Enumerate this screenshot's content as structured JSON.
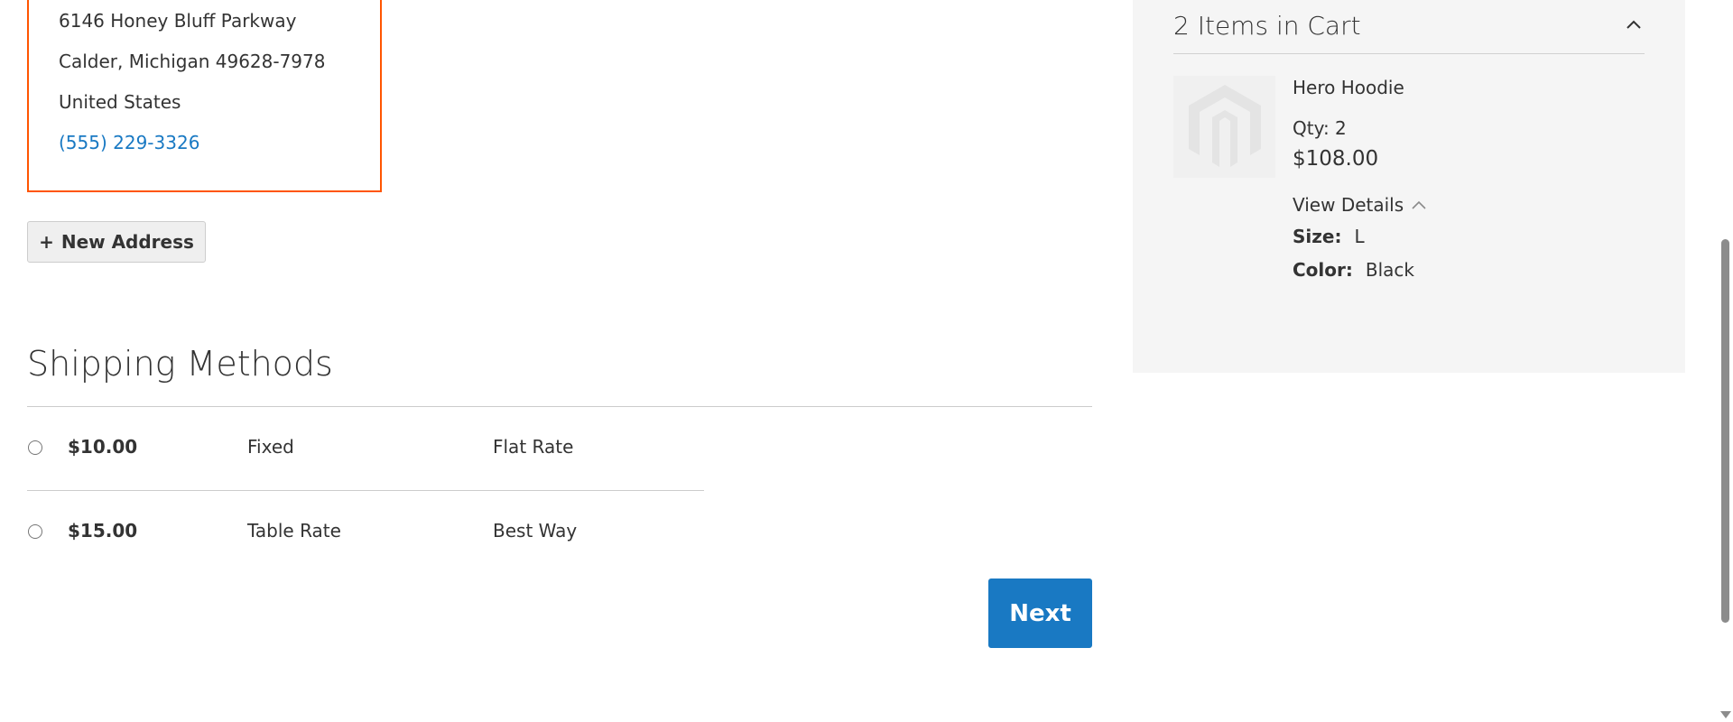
{
  "shipping_address": {
    "street": "6146 Honey Bluff Parkway",
    "city_region_zip": "Calder, Michigan 49628-7978",
    "country": "United States",
    "phone": "(555) 229-3326"
  },
  "new_address_button": {
    "icon": "+",
    "label": "New Address"
  },
  "shipping_methods": {
    "title": "Shipping Methods",
    "options": [
      {
        "price": "$10.00",
        "method": "Fixed",
        "carrier": "Flat Rate",
        "selected": false
      },
      {
        "price": "$15.00",
        "method": "Table Rate",
        "carrier": "Best Way",
        "selected": false
      }
    ]
  },
  "next_button": {
    "label": "Next"
  },
  "order_summary": {
    "cart_title": "2 Items in Cart",
    "item": {
      "name": "Hero Hoodie",
      "qty": "Qty: 2",
      "price": "$108.00",
      "view_details": "View Details",
      "options": [
        {
          "label": "Size:",
          "value": "L"
        },
        {
          "label": "Color:",
          "value": "Black"
        }
      ]
    }
  },
  "colors": {
    "accent_blue": "#1979c3",
    "selected_border": "#ff5501",
    "summary_background": "#f5f5f5"
  }
}
